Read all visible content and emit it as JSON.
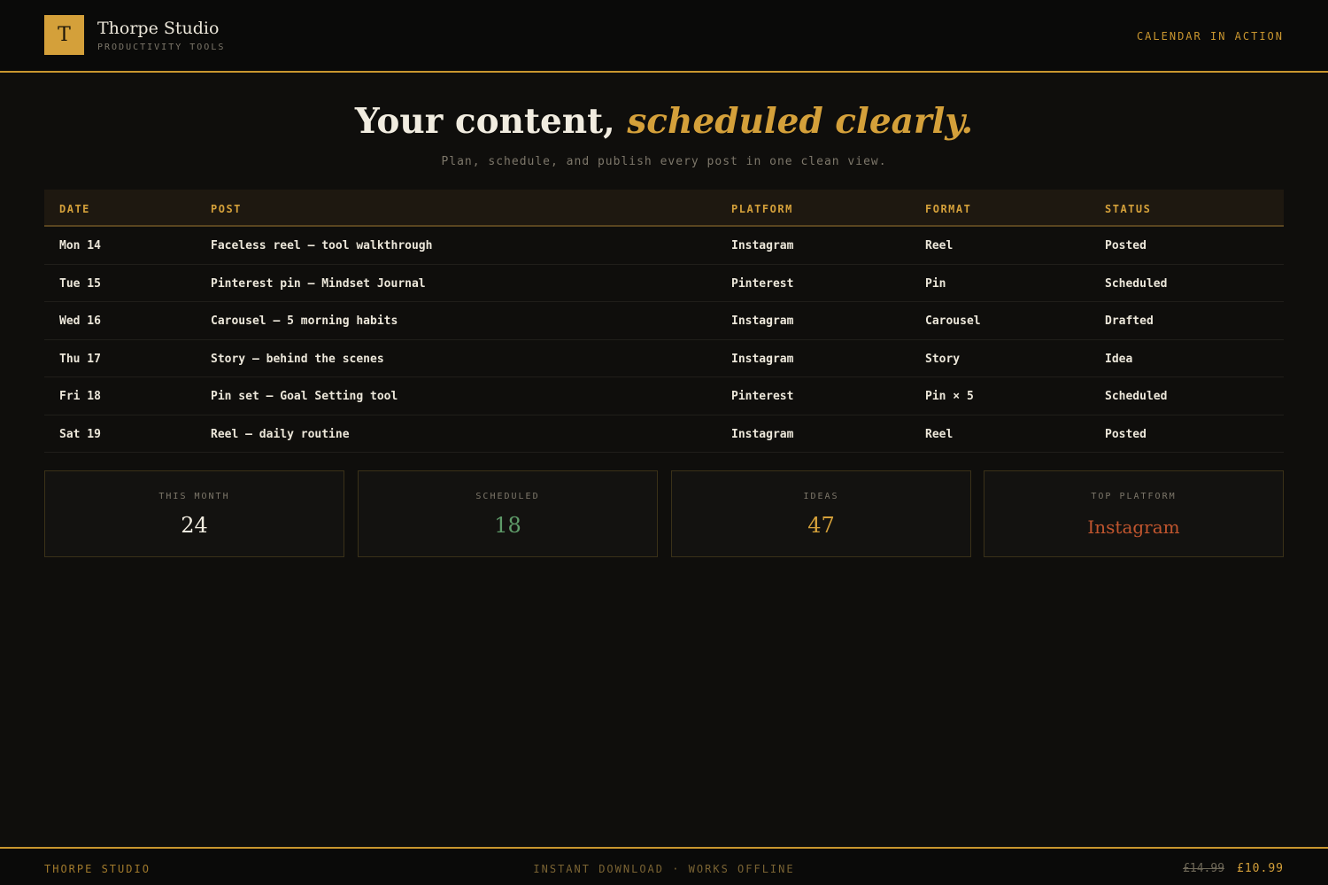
{
  "header": {
    "logo_letter": "T",
    "brand_name": "Thorpe Studio",
    "brand_sub": "PRODUCTIVITY TOOLS",
    "nav_link": "CALENDAR IN ACTION"
  },
  "hero": {
    "title_main": "Your content, ",
    "title_accent": "scheduled clearly.",
    "subtitle": "Plan, schedule, and publish every post in one clean view."
  },
  "table": {
    "columns": [
      "DATE",
      "POST",
      "PLATFORM",
      "FORMAT",
      "STATUS"
    ],
    "rows": [
      [
        "Mon 14",
        "Faceless reel — tool walkthrough",
        "Instagram",
        "Reel",
        "Posted"
      ],
      [
        "Tue 15",
        "Pinterest pin — Mindset Journal",
        "Pinterest",
        "Pin",
        "Scheduled"
      ],
      [
        "Wed 16",
        "Carousel — 5 morning habits",
        "Instagram",
        "Carousel",
        "Drafted"
      ],
      [
        "Thu 17",
        "Story — behind the scenes",
        "Instagram",
        "Story",
        "Idea"
      ],
      [
        "Fri 18",
        "Pin set — Goal Setting tool",
        "Pinterest",
        "Pin × 5",
        "Scheduled"
      ],
      [
        "Sat 19",
        "Reel — daily routine",
        "Instagram",
        "Reel",
        "Posted"
      ]
    ]
  },
  "stats": [
    {
      "label": "THIS MONTH",
      "value": "24",
      "color": "#f1ece0"
    },
    {
      "label": "SCHEDULED",
      "value": "18",
      "color": "#5e9a68"
    },
    {
      "label": "IDEAS",
      "value": "47",
      "color": "#d4a03a"
    },
    {
      "label": "TOP PLATFORM",
      "value": "Instagram",
      "color": "#c0552e"
    }
  ],
  "footer": {
    "left": "THORPE STUDIO",
    "center": "INSTANT DOWNLOAD · WORKS OFFLINE",
    "price_old": "£14.99",
    "price_new": "£10.99"
  },
  "colors": {
    "accent": "#d4a03a",
    "background": "#0f0e0c"
  }
}
